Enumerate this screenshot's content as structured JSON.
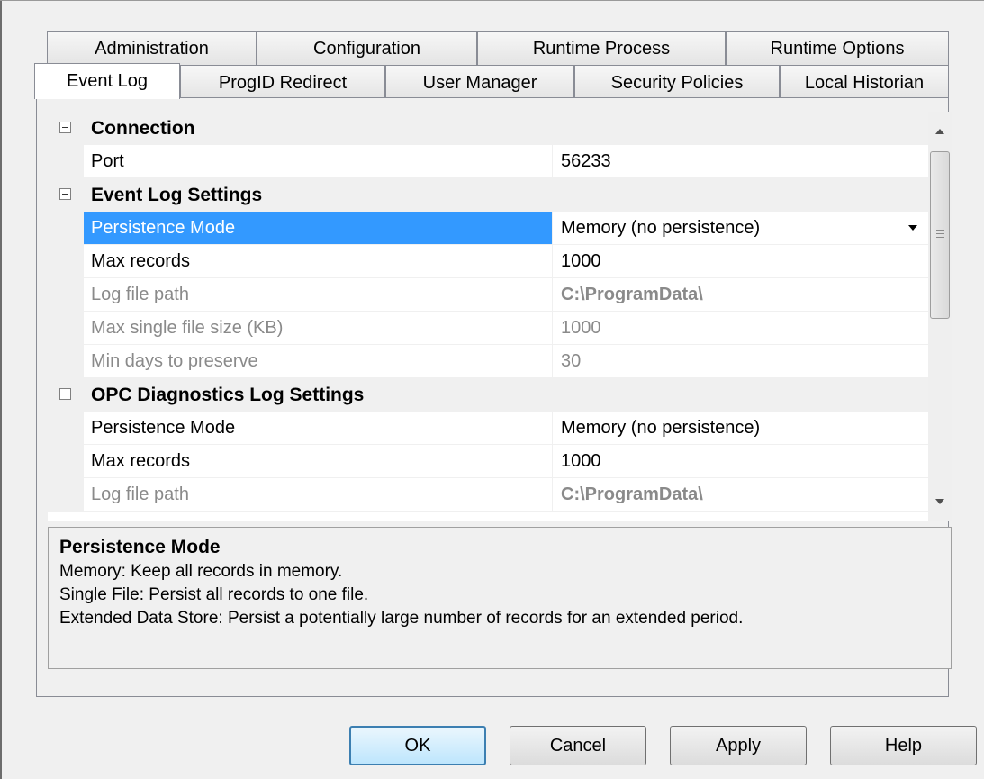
{
  "tabs_back": [
    "Administration",
    "Configuration",
    "Runtime Process",
    "Runtime Options"
  ],
  "tabs_front": [
    "Event Log",
    "ProgID Redirect",
    "User Manager",
    "Security Policies",
    "Local Historian"
  ],
  "active_tab": "Event Log",
  "grid": {
    "connection": {
      "title": "Connection",
      "port_name": "Port",
      "port_value": "56233"
    },
    "event_log": {
      "title": "Event Log Settings",
      "persistence_name": "Persistence Mode",
      "persistence_value": "Memory (no persistence)",
      "max_records_name": "Max records",
      "max_records_value": "1000",
      "log_path_name": "Log file path",
      "log_path_value": "C:\\ProgramData\\",
      "max_size_name": "Max single file size (KB)",
      "max_size_value": "1000",
      "min_days_name": "Min days to preserve",
      "min_days_value": "30"
    },
    "opc_log": {
      "title": "OPC Diagnostics Log Settings",
      "persistence_name": "Persistence Mode",
      "persistence_value": "Memory (no persistence)",
      "max_records_name": "Max records",
      "max_records_value": "1000",
      "log_path_name": "Log file path",
      "log_path_value": "C:\\ProgramData\\"
    }
  },
  "description": {
    "title": "Persistence Mode",
    "lines": [
      "Memory: Keep all records in memory.",
      "Single File: Persist all records to one file.",
      "Extended Data Store: Persist a potentially large number of records for an extended period."
    ]
  },
  "buttons": {
    "ok": "OK",
    "cancel": "Cancel",
    "apply": "Apply",
    "help": "Help"
  },
  "colors": {
    "selection": "#3399ff",
    "disabled_text": "#8a8a8a",
    "default_button_border": "#3c7fb1"
  }
}
